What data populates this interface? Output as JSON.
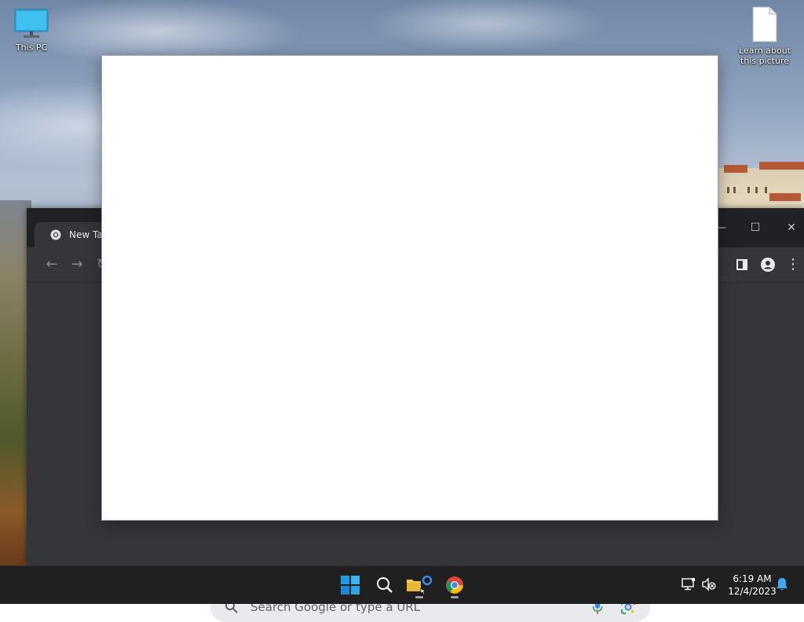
{
  "desktop": {
    "icons": [
      {
        "label": "This PC",
        "icon": "monitor-icon"
      },
      {
        "label": "Learn about this picture",
        "icon": "document-icon"
      }
    ]
  },
  "chrome": {
    "tab_title": "New Tab",
    "search_placeholder": "Search Google or type a URL",
    "window_controls": {
      "minimize": "—",
      "maximize": "☐",
      "close": "✕"
    }
  },
  "taskbar": {
    "apps": [
      "start-icon",
      "search-icon",
      "file-explorer-icon",
      "chrome-icon"
    ],
    "time": "6:19 AM",
    "date": "12/4/2023"
  },
  "colors": {
    "chrome_dark": "#202124",
    "chrome_toolbar": "#35363a",
    "taskbar": "#202020",
    "accent": "#1a73e8"
  }
}
